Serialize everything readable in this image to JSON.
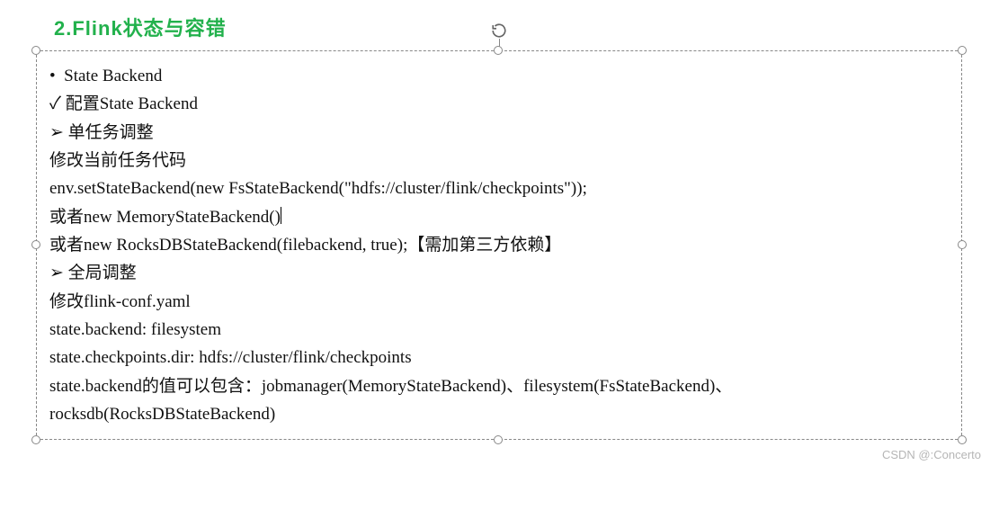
{
  "title": "2.Flink状态与容错",
  "lines": {
    "l0": "•  State Backend",
    "l1": "✓ 配置State Backend",
    "l2": "➢ 单任务调整",
    "l3": "修改当前任务代码",
    "l4": "env.setStateBackend(new FsStateBackend(\"hdfs://cluster/flink/checkpoints\"));",
    "l5a": "或者new MemoryStateBackend()",
    "l6": "或者new RocksDBStateBackend(filebackend, true);【需加第三方依赖】",
    "l7": "➢ 全局调整",
    "l8": "修改flink-conf.yaml",
    "l9": "state.backend: filesystem",
    "l10": "state.checkpoints.dir: hdfs://cluster/flink/checkpoints",
    "l11": "state.backend的值可以包含：jobmanager(MemoryStateBackend)、filesystem(FsStateBackend)、",
    "l12": "rocksdb(RocksDBStateBackend)"
  },
  "watermark": "CSDN @:Concerto"
}
